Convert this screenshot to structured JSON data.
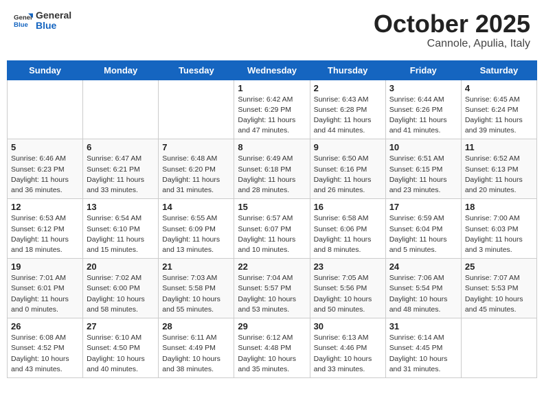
{
  "header": {
    "logo_general": "General",
    "logo_blue": "Blue",
    "month": "October 2025",
    "location": "Cannole, Apulia, Italy"
  },
  "days_of_week": [
    "Sunday",
    "Monday",
    "Tuesday",
    "Wednesday",
    "Thursday",
    "Friday",
    "Saturday"
  ],
  "weeks": [
    [
      {
        "day": "",
        "info": ""
      },
      {
        "day": "",
        "info": ""
      },
      {
        "day": "",
        "info": ""
      },
      {
        "day": "1",
        "info": "Sunrise: 6:42 AM\nSunset: 6:29 PM\nDaylight: 11 hours\nand 47 minutes."
      },
      {
        "day": "2",
        "info": "Sunrise: 6:43 AM\nSunset: 6:28 PM\nDaylight: 11 hours\nand 44 minutes."
      },
      {
        "day": "3",
        "info": "Sunrise: 6:44 AM\nSunset: 6:26 PM\nDaylight: 11 hours\nand 41 minutes."
      },
      {
        "day": "4",
        "info": "Sunrise: 6:45 AM\nSunset: 6:24 PM\nDaylight: 11 hours\nand 39 minutes."
      }
    ],
    [
      {
        "day": "5",
        "info": "Sunrise: 6:46 AM\nSunset: 6:23 PM\nDaylight: 11 hours\nand 36 minutes."
      },
      {
        "day": "6",
        "info": "Sunrise: 6:47 AM\nSunset: 6:21 PM\nDaylight: 11 hours\nand 33 minutes."
      },
      {
        "day": "7",
        "info": "Sunrise: 6:48 AM\nSunset: 6:20 PM\nDaylight: 11 hours\nand 31 minutes."
      },
      {
        "day": "8",
        "info": "Sunrise: 6:49 AM\nSunset: 6:18 PM\nDaylight: 11 hours\nand 28 minutes."
      },
      {
        "day": "9",
        "info": "Sunrise: 6:50 AM\nSunset: 6:16 PM\nDaylight: 11 hours\nand 26 minutes."
      },
      {
        "day": "10",
        "info": "Sunrise: 6:51 AM\nSunset: 6:15 PM\nDaylight: 11 hours\nand 23 minutes."
      },
      {
        "day": "11",
        "info": "Sunrise: 6:52 AM\nSunset: 6:13 PM\nDaylight: 11 hours\nand 20 minutes."
      }
    ],
    [
      {
        "day": "12",
        "info": "Sunrise: 6:53 AM\nSunset: 6:12 PM\nDaylight: 11 hours\nand 18 minutes."
      },
      {
        "day": "13",
        "info": "Sunrise: 6:54 AM\nSunset: 6:10 PM\nDaylight: 11 hours\nand 15 minutes."
      },
      {
        "day": "14",
        "info": "Sunrise: 6:55 AM\nSunset: 6:09 PM\nDaylight: 11 hours\nand 13 minutes."
      },
      {
        "day": "15",
        "info": "Sunrise: 6:57 AM\nSunset: 6:07 PM\nDaylight: 11 hours\nand 10 minutes."
      },
      {
        "day": "16",
        "info": "Sunrise: 6:58 AM\nSunset: 6:06 PM\nDaylight: 11 hours\nand 8 minutes."
      },
      {
        "day": "17",
        "info": "Sunrise: 6:59 AM\nSunset: 6:04 PM\nDaylight: 11 hours\nand 5 minutes."
      },
      {
        "day": "18",
        "info": "Sunrise: 7:00 AM\nSunset: 6:03 PM\nDaylight: 11 hours\nand 3 minutes."
      }
    ],
    [
      {
        "day": "19",
        "info": "Sunrise: 7:01 AM\nSunset: 6:01 PM\nDaylight: 11 hours\nand 0 minutes."
      },
      {
        "day": "20",
        "info": "Sunrise: 7:02 AM\nSunset: 6:00 PM\nDaylight: 10 hours\nand 58 minutes."
      },
      {
        "day": "21",
        "info": "Sunrise: 7:03 AM\nSunset: 5:58 PM\nDaylight: 10 hours\nand 55 minutes."
      },
      {
        "day": "22",
        "info": "Sunrise: 7:04 AM\nSunset: 5:57 PM\nDaylight: 10 hours\nand 53 minutes."
      },
      {
        "day": "23",
        "info": "Sunrise: 7:05 AM\nSunset: 5:56 PM\nDaylight: 10 hours\nand 50 minutes."
      },
      {
        "day": "24",
        "info": "Sunrise: 7:06 AM\nSunset: 5:54 PM\nDaylight: 10 hours\nand 48 minutes."
      },
      {
        "day": "25",
        "info": "Sunrise: 7:07 AM\nSunset: 5:53 PM\nDaylight: 10 hours\nand 45 minutes."
      }
    ],
    [
      {
        "day": "26",
        "info": "Sunrise: 6:08 AM\nSunset: 4:52 PM\nDaylight: 10 hours\nand 43 minutes."
      },
      {
        "day": "27",
        "info": "Sunrise: 6:10 AM\nSunset: 4:50 PM\nDaylight: 10 hours\nand 40 minutes."
      },
      {
        "day": "28",
        "info": "Sunrise: 6:11 AM\nSunset: 4:49 PM\nDaylight: 10 hours\nand 38 minutes."
      },
      {
        "day": "29",
        "info": "Sunrise: 6:12 AM\nSunset: 4:48 PM\nDaylight: 10 hours\nand 35 minutes."
      },
      {
        "day": "30",
        "info": "Sunrise: 6:13 AM\nSunset: 4:46 PM\nDaylight: 10 hours\nand 33 minutes."
      },
      {
        "day": "31",
        "info": "Sunrise: 6:14 AM\nSunset: 4:45 PM\nDaylight: 10 hours\nand 31 minutes."
      },
      {
        "day": "",
        "info": ""
      }
    ]
  ]
}
